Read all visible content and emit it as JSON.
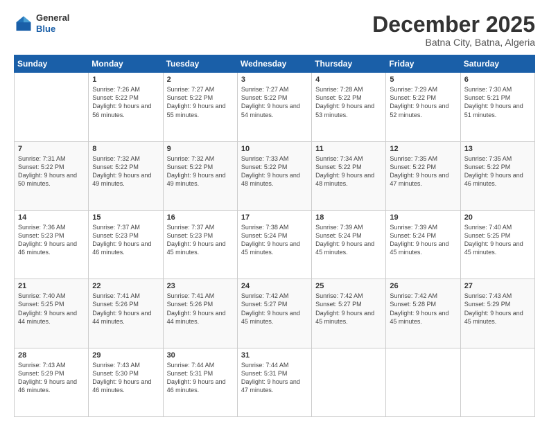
{
  "header": {
    "logo": {
      "line1": "General",
      "line2": "Blue"
    },
    "title": "December 2025",
    "subtitle": "Batna City, Batna, Algeria"
  },
  "days_of_week": [
    "Sunday",
    "Monday",
    "Tuesday",
    "Wednesday",
    "Thursday",
    "Friday",
    "Saturday"
  ],
  "weeks": [
    [
      {
        "day": "",
        "sunrise": "",
        "sunset": "",
        "daylight": ""
      },
      {
        "day": "1",
        "sunrise": "Sunrise: 7:26 AM",
        "sunset": "Sunset: 5:22 PM",
        "daylight": "Daylight: 9 hours and 56 minutes."
      },
      {
        "day": "2",
        "sunrise": "Sunrise: 7:27 AM",
        "sunset": "Sunset: 5:22 PM",
        "daylight": "Daylight: 9 hours and 55 minutes."
      },
      {
        "day": "3",
        "sunrise": "Sunrise: 7:27 AM",
        "sunset": "Sunset: 5:22 PM",
        "daylight": "Daylight: 9 hours and 54 minutes."
      },
      {
        "day": "4",
        "sunrise": "Sunrise: 7:28 AM",
        "sunset": "Sunset: 5:22 PM",
        "daylight": "Daylight: 9 hours and 53 minutes."
      },
      {
        "day": "5",
        "sunrise": "Sunrise: 7:29 AM",
        "sunset": "Sunset: 5:22 PM",
        "daylight": "Daylight: 9 hours and 52 minutes."
      },
      {
        "day": "6",
        "sunrise": "Sunrise: 7:30 AM",
        "sunset": "Sunset: 5:21 PM",
        "daylight": "Daylight: 9 hours and 51 minutes."
      }
    ],
    [
      {
        "day": "7",
        "sunrise": "Sunrise: 7:31 AM",
        "sunset": "Sunset: 5:22 PM",
        "daylight": "Daylight: 9 hours and 50 minutes."
      },
      {
        "day": "8",
        "sunrise": "Sunrise: 7:32 AM",
        "sunset": "Sunset: 5:22 PM",
        "daylight": "Daylight: 9 hours and 49 minutes."
      },
      {
        "day": "9",
        "sunrise": "Sunrise: 7:32 AM",
        "sunset": "Sunset: 5:22 PM",
        "daylight": "Daylight: 9 hours and 49 minutes."
      },
      {
        "day": "10",
        "sunrise": "Sunrise: 7:33 AM",
        "sunset": "Sunset: 5:22 PM",
        "daylight": "Daylight: 9 hours and 48 minutes."
      },
      {
        "day": "11",
        "sunrise": "Sunrise: 7:34 AM",
        "sunset": "Sunset: 5:22 PM",
        "daylight": "Daylight: 9 hours and 48 minutes."
      },
      {
        "day": "12",
        "sunrise": "Sunrise: 7:35 AM",
        "sunset": "Sunset: 5:22 PM",
        "daylight": "Daylight: 9 hours and 47 minutes."
      },
      {
        "day": "13",
        "sunrise": "Sunrise: 7:35 AM",
        "sunset": "Sunset: 5:22 PM",
        "daylight": "Daylight: 9 hours and 46 minutes."
      }
    ],
    [
      {
        "day": "14",
        "sunrise": "Sunrise: 7:36 AM",
        "sunset": "Sunset: 5:23 PM",
        "daylight": "Daylight: 9 hours and 46 minutes."
      },
      {
        "day": "15",
        "sunrise": "Sunrise: 7:37 AM",
        "sunset": "Sunset: 5:23 PM",
        "daylight": "Daylight: 9 hours and 46 minutes."
      },
      {
        "day": "16",
        "sunrise": "Sunrise: 7:37 AM",
        "sunset": "Sunset: 5:23 PM",
        "daylight": "Daylight: 9 hours and 45 minutes."
      },
      {
        "day": "17",
        "sunrise": "Sunrise: 7:38 AM",
        "sunset": "Sunset: 5:24 PM",
        "daylight": "Daylight: 9 hours and 45 minutes."
      },
      {
        "day": "18",
        "sunrise": "Sunrise: 7:39 AM",
        "sunset": "Sunset: 5:24 PM",
        "daylight": "Daylight: 9 hours and 45 minutes."
      },
      {
        "day": "19",
        "sunrise": "Sunrise: 7:39 AM",
        "sunset": "Sunset: 5:24 PM",
        "daylight": "Daylight: 9 hours and 45 minutes."
      },
      {
        "day": "20",
        "sunrise": "Sunrise: 7:40 AM",
        "sunset": "Sunset: 5:25 PM",
        "daylight": "Daylight: 9 hours and 45 minutes."
      }
    ],
    [
      {
        "day": "21",
        "sunrise": "Sunrise: 7:40 AM",
        "sunset": "Sunset: 5:25 PM",
        "daylight": "Daylight: 9 hours and 44 minutes."
      },
      {
        "day": "22",
        "sunrise": "Sunrise: 7:41 AM",
        "sunset": "Sunset: 5:26 PM",
        "daylight": "Daylight: 9 hours and 44 minutes."
      },
      {
        "day": "23",
        "sunrise": "Sunrise: 7:41 AM",
        "sunset": "Sunset: 5:26 PM",
        "daylight": "Daylight: 9 hours and 44 minutes."
      },
      {
        "day": "24",
        "sunrise": "Sunrise: 7:42 AM",
        "sunset": "Sunset: 5:27 PM",
        "daylight": "Daylight: 9 hours and 45 minutes."
      },
      {
        "day": "25",
        "sunrise": "Sunrise: 7:42 AM",
        "sunset": "Sunset: 5:27 PM",
        "daylight": "Daylight: 9 hours and 45 minutes."
      },
      {
        "day": "26",
        "sunrise": "Sunrise: 7:42 AM",
        "sunset": "Sunset: 5:28 PM",
        "daylight": "Daylight: 9 hours and 45 minutes."
      },
      {
        "day": "27",
        "sunrise": "Sunrise: 7:43 AM",
        "sunset": "Sunset: 5:29 PM",
        "daylight": "Daylight: 9 hours and 45 minutes."
      }
    ],
    [
      {
        "day": "28",
        "sunrise": "Sunrise: 7:43 AM",
        "sunset": "Sunset: 5:29 PM",
        "daylight": "Daylight: 9 hours and 46 minutes."
      },
      {
        "day": "29",
        "sunrise": "Sunrise: 7:43 AM",
        "sunset": "Sunset: 5:30 PM",
        "daylight": "Daylight: 9 hours and 46 minutes."
      },
      {
        "day": "30",
        "sunrise": "Sunrise: 7:44 AM",
        "sunset": "Sunset: 5:31 PM",
        "daylight": "Daylight: 9 hours and 46 minutes."
      },
      {
        "day": "31",
        "sunrise": "Sunrise: 7:44 AM",
        "sunset": "Sunset: 5:31 PM",
        "daylight": "Daylight: 9 hours and 47 minutes."
      },
      {
        "day": "",
        "sunrise": "",
        "sunset": "",
        "daylight": ""
      },
      {
        "day": "",
        "sunrise": "",
        "sunset": "",
        "daylight": ""
      },
      {
        "day": "",
        "sunrise": "",
        "sunset": "",
        "daylight": ""
      }
    ]
  ]
}
